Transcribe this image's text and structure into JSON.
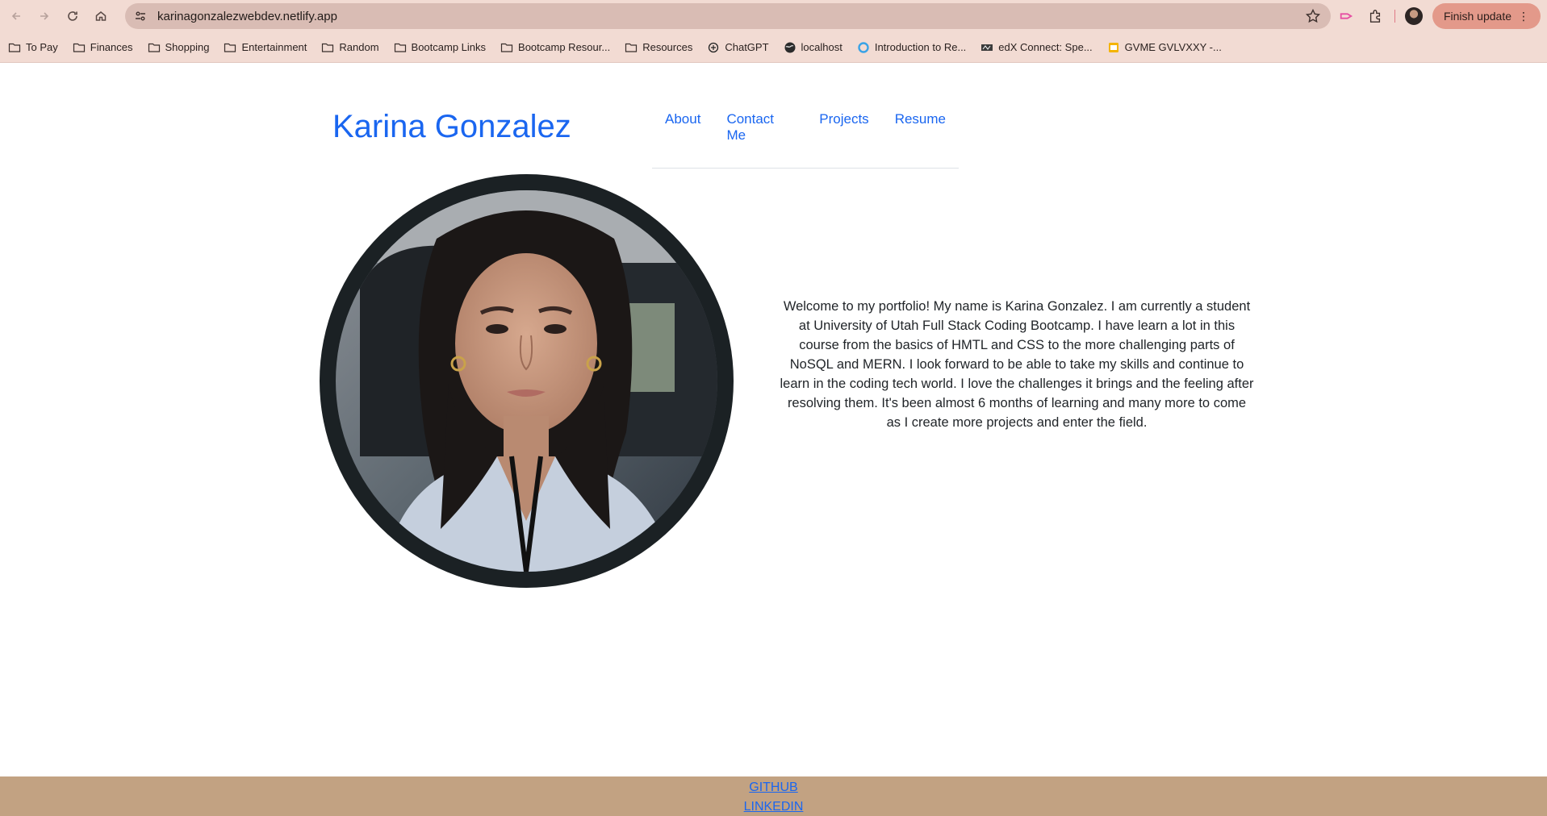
{
  "browser": {
    "url": "karinagonzalezwebdev.netlify.app",
    "finish_update_label": "Finish update",
    "bookmarks": [
      {
        "label": "To Pay",
        "icon": "folder-icon"
      },
      {
        "label": "Finances",
        "icon": "folder-icon"
      },
      {
        "label": "Shopping",
        "icon": "folder-icon"
      },
      {
        "label": "Entertainment",
        "icon": "folder-icon"
      },
      {
        "label": "Random",
        "icon": "folder-icon"
      },
      {
        "label": "Bootcamp Links",
        "icon": "folder-icon"
      },
      {
        "label": "Bootcamp Resour...",
        "icon": "folder-icon"
      },
      {
        "label": "Resources",
        "icon": "folder-icon"
      },
      {
        "label": "ChatGPT",
        "icon": "chatgpt-icon"
      },
      {
        "label": "localhost",
        "icon": "globe-icon"
      },
      {
        "label": "Introduction to Re...",
        "icon": "circle-icon"
      },
      {
        "label": "edX Connect: Spe...",
        "icon": "edx-icon"
      },
      {
        "label": "GVME GVLVXXY -...",
        "icon": "slides-icon"
      }
    ]
  },
  "site": {
    "title": "Karina Gonzalez",
    "nav": [
      "About",
      "Contact Me",
      "Projects",
      "Resume"
    ],
    "intro": "Welcome to my portfolio! My name is Karina Gonzalez. I am currently a student at University of Utah Full Stack Coding Bootcamp. I have learn a lot in this course from the basics of HMTL and CSS to the more challenging parts of NoSQL and MERN. I look forward to be able to take my skills and continue to learn in the coding tech world. I love the challenges it brings and the feeling after resolving them. It's been almost 6 months of learning and many more to come as I create more projects and enter the field.",
    "footer_links": [
      "GITHUB",
      "LINKEDIN"
    ]
  },
  "colors": {
    "brand_blue": "#1a66f0",
    "footer_bg": "#c2a282",
    "chrome_bg": "#f2dbd3"
  }
}
